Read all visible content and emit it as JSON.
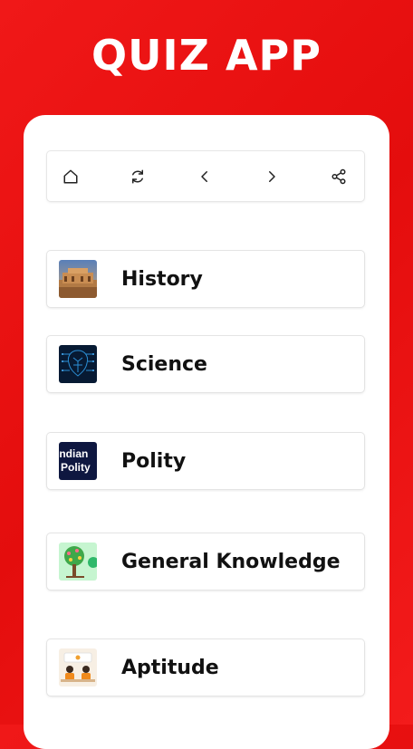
{
  "app": {
    "title": "QUIZ APP"
  },
  "toolbar": {
    "buttons": [
      {
        "icon": "home-icon"
      },
      {
        "icon": "refresh-icon"
      },
      {
        "icon": "chevron-left-icon"
      },
      {
        "icon": "chevron-right-icon"
      },
      {
        "icon": "share-icon"
      }
    ]
  },
  "categories": [
    {
      "label": "History",
      "icon": "history-thumbnail"
    },
    {
      "label": "Science",
      "icon": "science-thumbnail"
    },
    {
      "label": "Polity",
      "icon": "polity-thumbnail",
      "thumb_text": [
        "Indian",
        "Polity"
      ]
    },
    {
      "label": "General Knowledge",
      "icon": "general-knowledge-thumbnail"
    },
    {
      "label": "Aptitude",
      "icon": "aptitude-thumbnail"
    }
  ],
  "colors": {
    "background": "#e8100f",
    "card": "#ffffff",
    "text": "#111111"
  }
}
